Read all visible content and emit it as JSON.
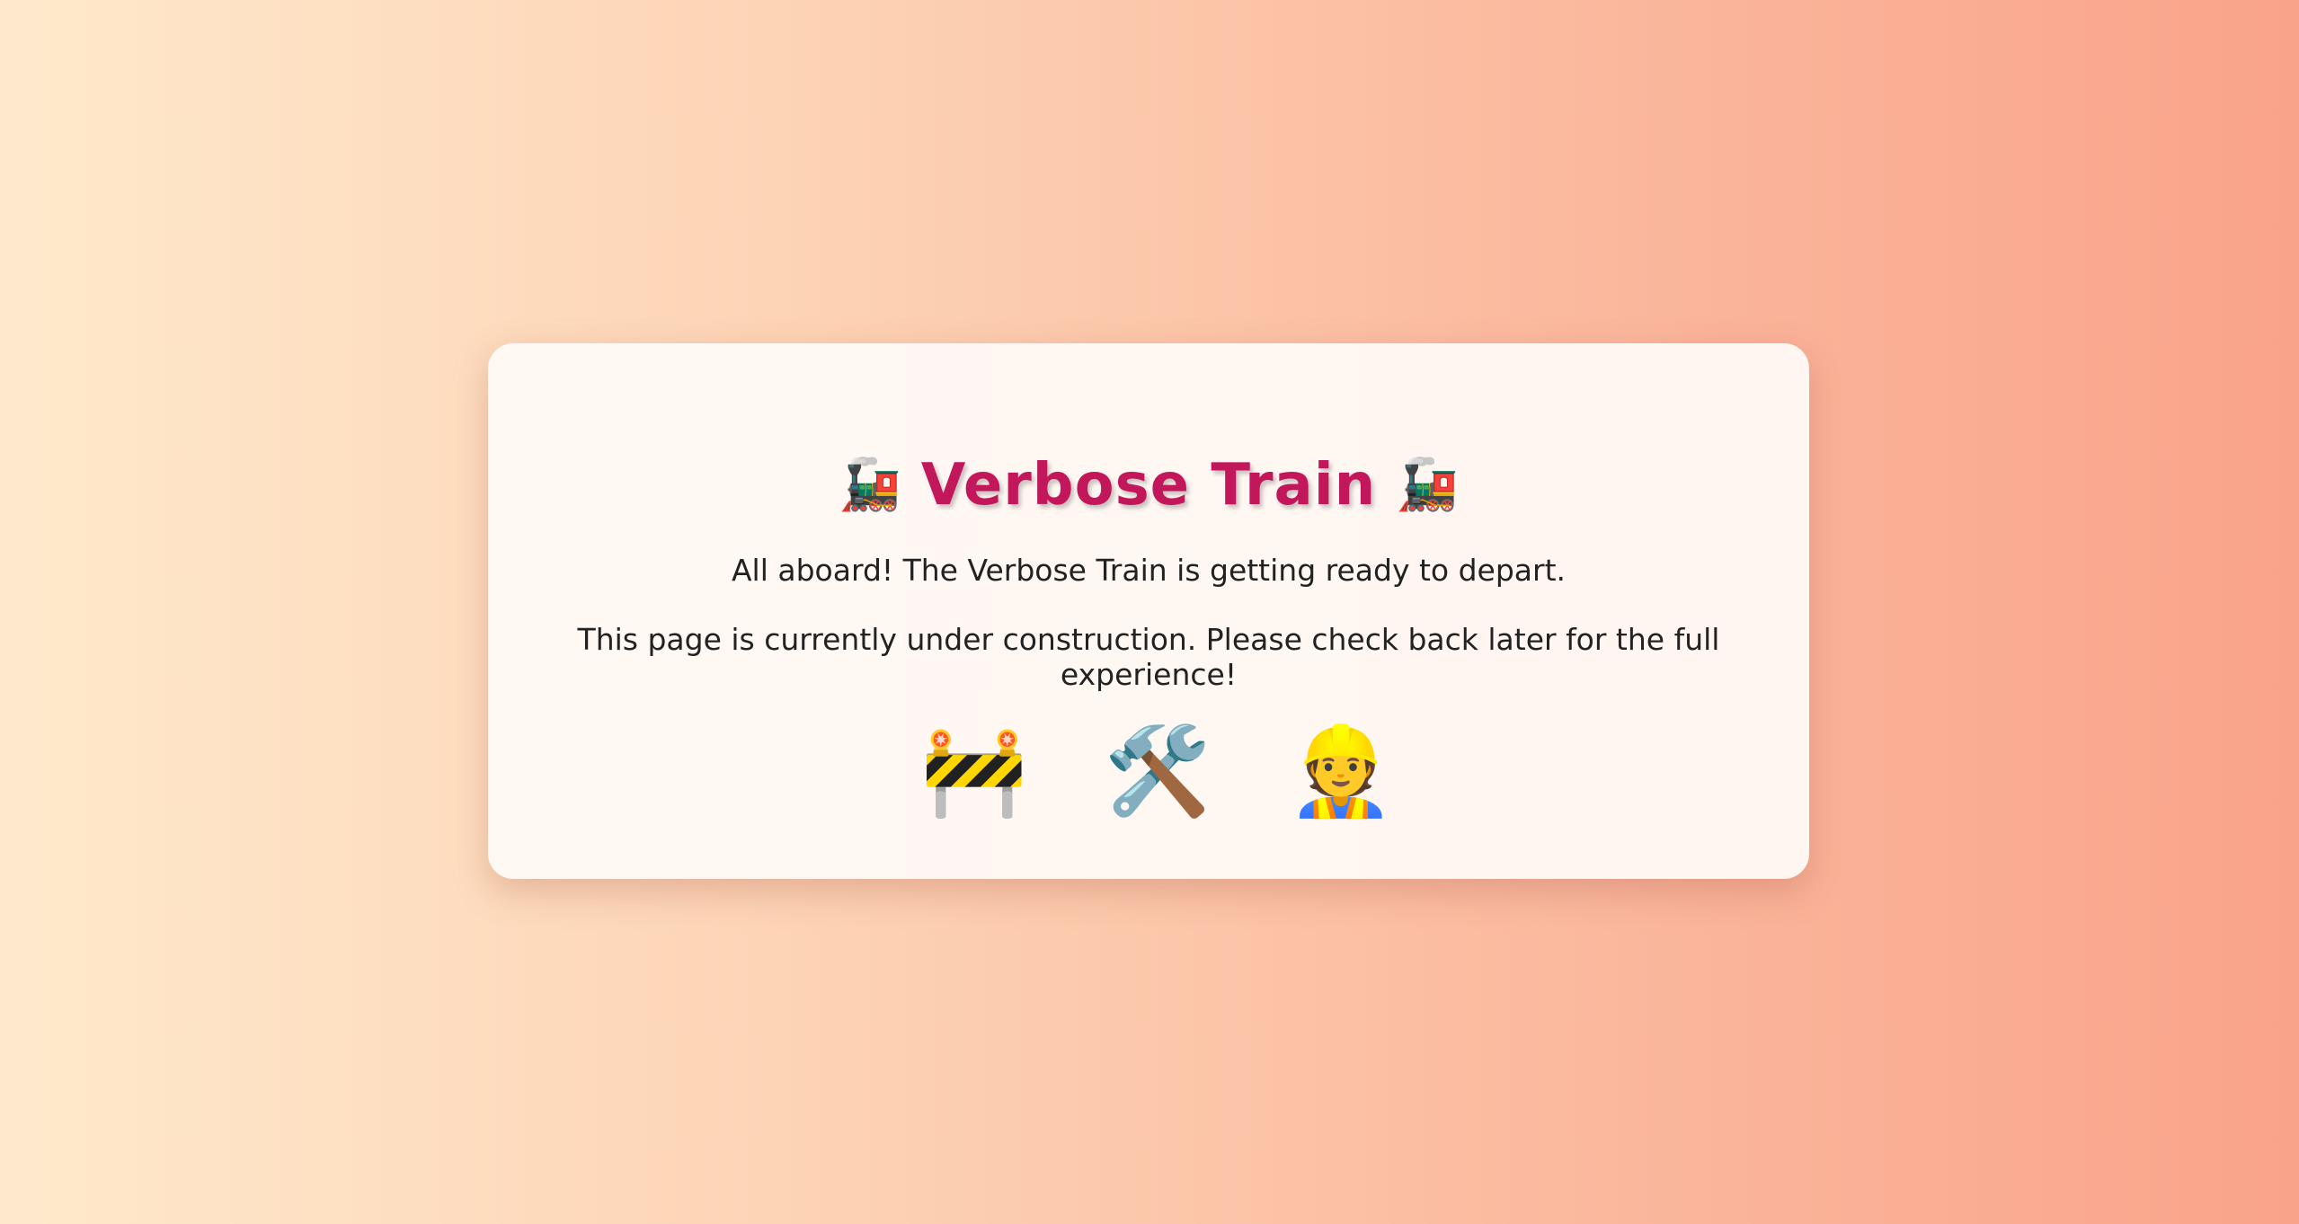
{
  "page": {
    "title": "Verbose Train",
    "title_icon_left": "🚂",
    "title_icon_right": "🚂",
    "line1": "All aboard! The Verbose Train is getting ready to depart.",
    "line2": "This page is currently under construction. Please check back later for the full experience!",
    "icons": [
      {
        "name": "construction-barrier-icon",
        "glyph": "🚧"
      },
      {
        "name": "hammer-and-wrench-icon",
        "glyph": "🛠️"
      },
      {
        "name": "construction-worker-icon",
        "glyph": "👷"
      }
    ]
  },
  "colors": {
    "title": "#c2185b",
    "text": "#222222"
  }
}
